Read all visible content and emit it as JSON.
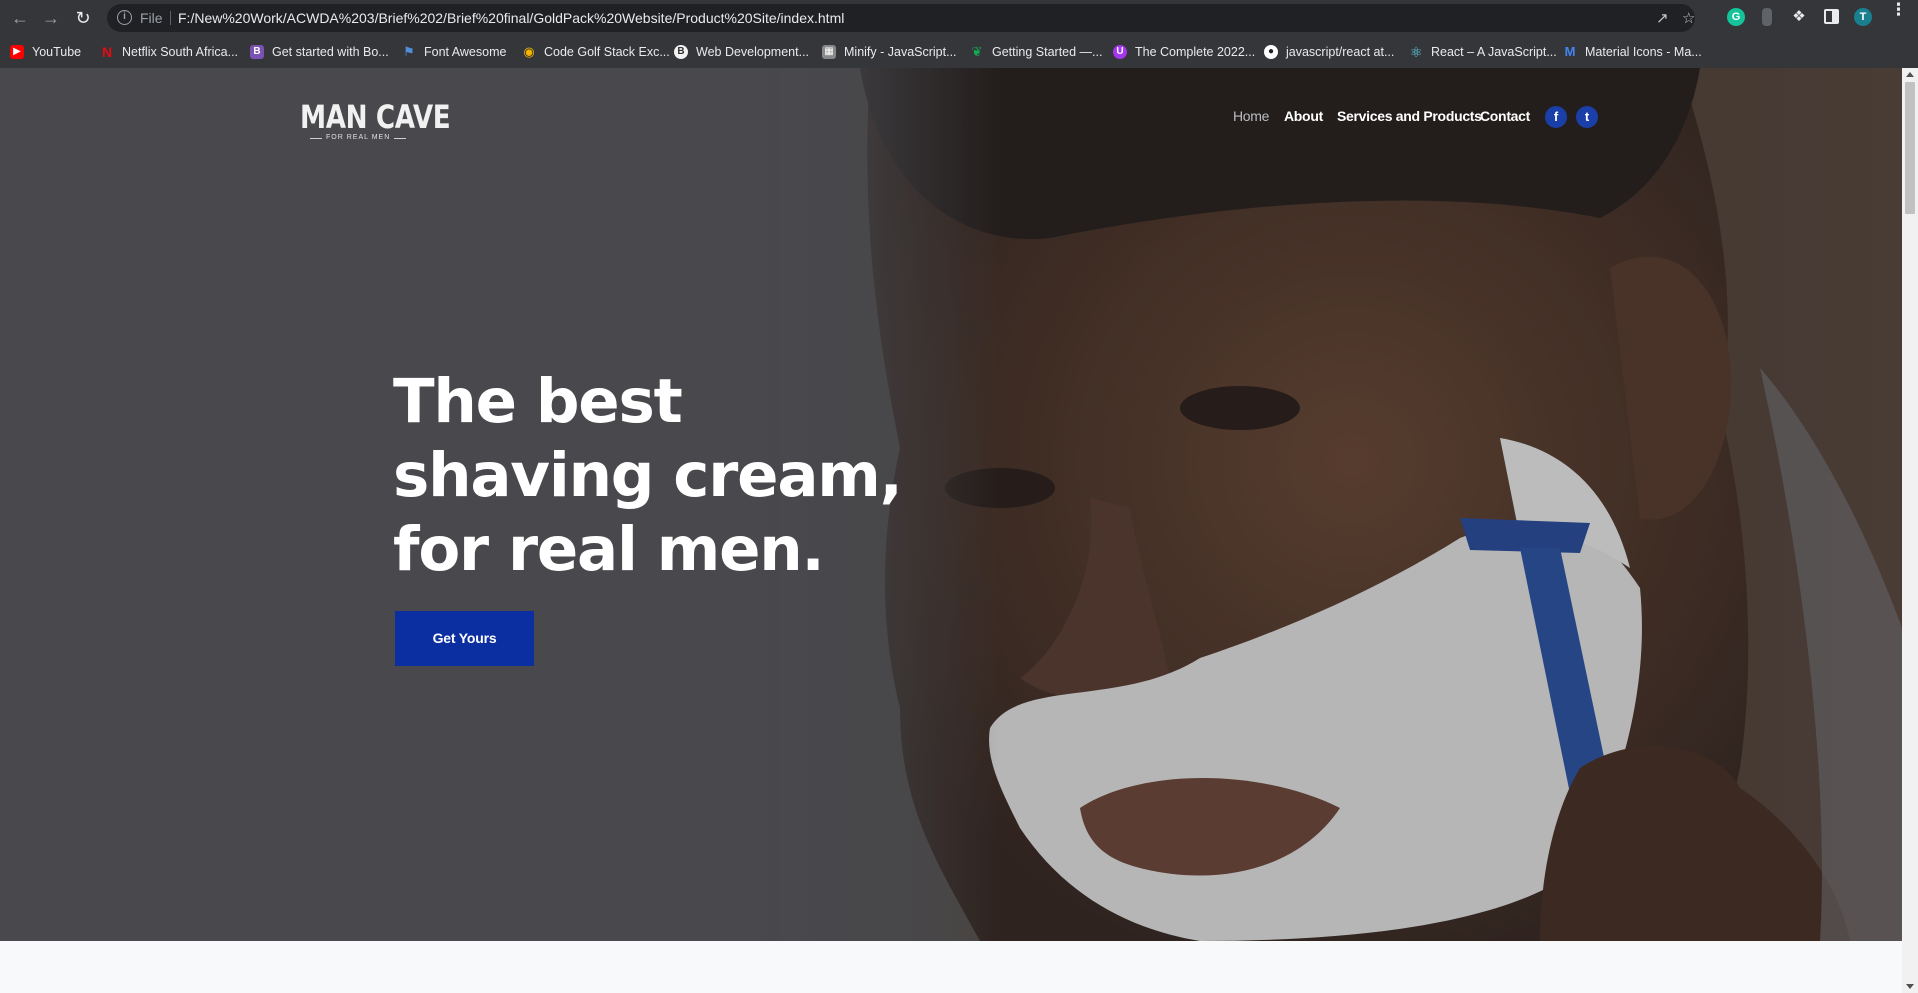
{
  "browser": {
    "url_scheme": "File",
    "url": "F:/New%20Work/ACWDA%203/Brief%202/Brief%20final/GoldPack%20Website/Product%20Site/index.html",
    "bookmarks": [
      {
        "label": "YouTube",
        "icon": "youtube-icon",
        "color": "#ff0000"
      },
      {
        "label": "Netflix South Africa...",
        "icon": "netflix-icon",
        "color": "#e50914"
      },
      {
        "label": "Get started with Bo...",
        "icon": "bootstrap-icon",
        "color": "#7952b3"
      },
      {
        "label": "Font Awesome",
        "icon": "flag-icon",
        "color": "#528dd7"
      },
      {
        "label": "Code Golf Stack Exc...",
        "icon": "medal-icon",
        "color": "#f4b400"
      },
      {
        "label": "Web Development...",
        "icon": "web-dev-icon",
        "color": "#f2f2f2"
      },
      {
        "label": "Minify - JavaScript...",
        "icon": "minify-icon",
        "color": "#888888"
      },
      {
        "label": "Getting Started —...",
        "icon": "mongodb-leaf-icon",
        "color": "#13aa52"
      },
      {
        "label": "The Complete 2022...",
        "icon": "udemy-icon",
        "color": "#a435f0"
      },
      {
        "label": "javascript/react at...",
        "icon": "github-icon",
        "color": "#ffffff"
      },
      {
        "label": "React – A JavaScript...",
        "icon": "react-icon",
        "color": "#61dafb"
      },
      {
        "label": "Material Icons - Ma...",
        "icon": "material-icons-icon",
        "color": "#4285f4"
      }
    ]
  },
  "site": {
    "logo": {
      "main": "MAN CAVE",
      "sub": "FOR REAL MEN"
    },
    "nav": [
      {
        "label": "Home",
        "active": true
      },
      {
        "label": "About",
        "active": false
      },
      {
        "label": "Services and Products",
        "active": false
      },
      {
        "label": "Contact",
        "active": false
      }
    ],
    "social": [
      {
        "icon": "facebook-icon",
        "glyph": "f"
      },
      {
        "icon": "twitter-icon",
        "glyph": "t"
      }
    ],
    "hero": {
      "headline": "The best shaving cream, for real men.",
      "cta": "Get Yours"
    },
    "colors": {
      "accent": "#0b2fa0",
      "social": "#1a3fa8",
      "hero_bg": "#48494d"
    }
  }
}
